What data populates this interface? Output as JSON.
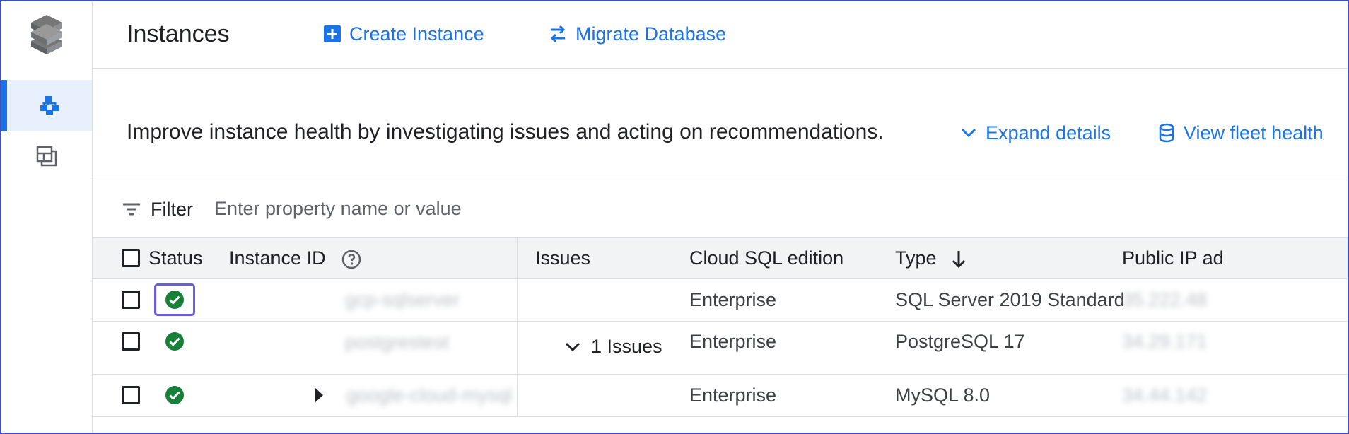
{
  "app": {
    "brand_icon": "stacked-layers-logo-icon"
  },
  "sidebar": {
    "items": [
      {
        "icon": "instances-icon",
        "active": true
      },
      {
        "icon": "fleet-dashboard-icon",
        "active": false
      }
    ]
  },
  "header": {
    "title": "Instances",
    "actions": [
      {
        "label": "Create Instance",
        "icon": "add-box-icon"
      },
      {
        "label": "Migrate Database",
        "icon": "swap-arrows-icon"
      }
    ]
  },
  "health": {
    "message": "Improve instance health by investigating issues and acting on recommendations.",
    "expand_label": "Expand details",
    "fleet_label": "View fleet health"
  },
  "filter": {
    "label": "Filter",
    "placeholder": "Enter property name or value"
  },
  "table": {
    "columns": {
      "status": "Status",
      "instance_id": "Instance ID",
      "issues": "Issues",
      "edition": "Cloud SQL edition",
      "type": "Type",
      "public_ip": "Public IP ad"
    },
    "rows": [
      {
        "instance_id": "gcp-sqlserver",
        "issues": "",
        "edition": "Enterprise",
        "type": "SQL Server 2019 Standard",
        "public_ip": "35.222.48",
        "status_icon": "success-check-icon"
      },
      {
        "instance_id": "postgrestest",
        "issues": "1 Issues",
        "edition": "Enterprise",
        "type": "PostgreSQL 17",
        "public_ip": "34.29.171",
        "status_icon": "success-check-icon"
      },
      {
        "instance_id": "google-cloud-mysql",
        "issues": "",
        "edition": "Enterprise",
        "type": "MySQL 8.0",
        "public_ip": "34.44.142",
        "status_icon": "success-check-icon"
      }
    ]
  },
  "colors": {
    "accent": "#1a73e8",
    "success": "#188038",
    "focus": "#6b5be6",
    "border": "#dadce0",
    "header_bg": "#f1f3f4"
  }
}
